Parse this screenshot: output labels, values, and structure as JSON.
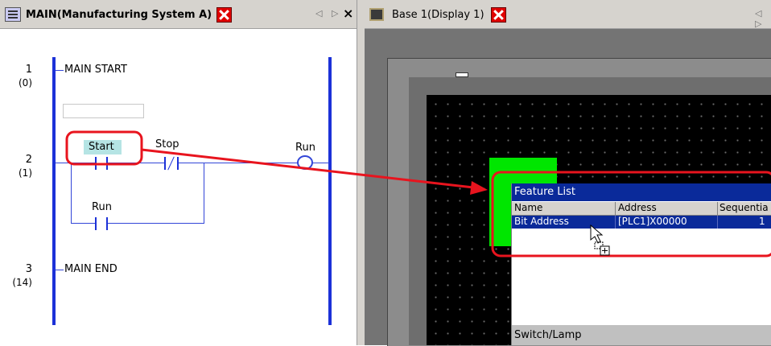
{
  "left_tab": {
    "title": "MAIN(Manufacturing System A)",
    "nav": "◁ ▷",
    "close_small": "×"
  },
  "right_tab": {
    "title": "Base 1(Display 1)",
    "nav": "◁ ▷"
  },
  "ladder": {
    "rungs": [
      {
        "number": "1",
        "step": "(0)",
        "label": "MAIN START"
      },
      {
        "number": "2",
        "step": "(1)"
      },
      {
        "number": "3",
        "step": "(14)",
        "label": "MAIN END"
      }
    ],
    "contacts": {
      "start": "Start",
      "stop": "Stop",
      "run_coil": "Run",
      "run_contact": "Run"
    }
  },
  "feature_list": {
    "title": "Feature List",
    "columns": [
      "Name",
      "Address",
      "Sequentia"
    ],
    "row": {
      "name": "Bit Address",
      "address": "[PLC1]X00000",
      "seq": "1"
    },
    "footer": "Switch/Lamp"
  },
  "colors": {
    "highlight": "#e8141e",
    "rail": "#1c31d8",
    "selection": "#0a2a9a",
    "green": "#00e600"
  }
}
